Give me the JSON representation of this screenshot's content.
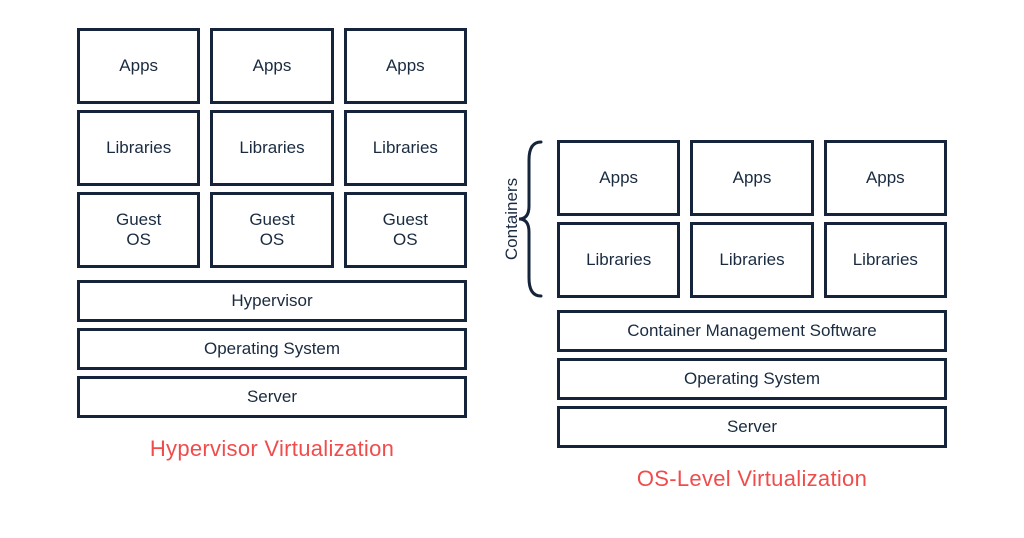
{
  "left": {
    "caption": "Hypervisor Virtualization",
    "columns": [
      {
        "app": "Apps",
        "lib": "Libraries",
        "os": "Guest\nOS"
      },
      {
        "app": "Apps",
        "lib": "Libraries",
        "os": "Guest\nOS"
      },
      {
        "app": "Apps",
        "lib": "Libraries",
        "os": "Guest\nOS"
      }
    ],
    "layers": {
      "hypervisor": "Hypervisor",
      "os": "Operating System",
      "server": "Server"
    }
  },
  "right": {
    "caption": "OS-Level Virtualization",
    "brace_label": "Containers",
    "columns": [
      {
        "app": "Apps",
        "lib": "Libraries"
      },
      {
        "app": "Apps",
        "lib": "Libraries"
      },
      {
        "app": "Apps",
        "lib": "Libraries"
      }
    ],
    "layers": {
      "cms": "Container Management Software",
      "os": "Operating System",
      "server": "Server"
    }
  },
  "colors": {
    "border": "#15243a",
    "caption": "#f04c4c"
  }
}
